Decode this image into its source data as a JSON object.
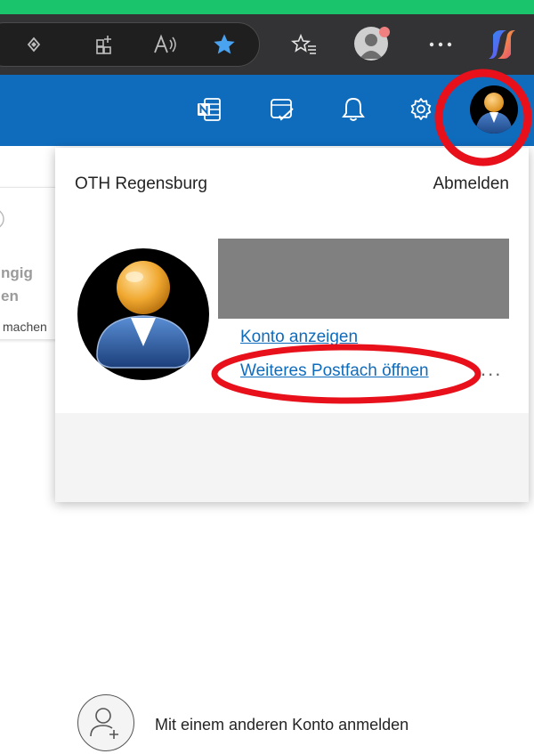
{
  "flyout": {
    "org_name": "OTH Regensburg",
    "sign_out_label": "Abmelden",
    "view_account_label": "Konto anzeigen",
    "open_mailbox_label": "Weiteres Postfach öffnen",
    "more_label": "...",
    "add_account_label": "Mit einem anderen Konto anmelden"
  },
  "background_page": {
    "fragment_1": "ngig",
    "fragment_2": "en",
    "fragment_3": "machen"
  },
  "colors": {
    "app_bar": "#0f6cbd",
    "browser_toolbar": "#333335",
    "link": "#0f6cbd",
    "annotation": "#e8101a"
  }
}
